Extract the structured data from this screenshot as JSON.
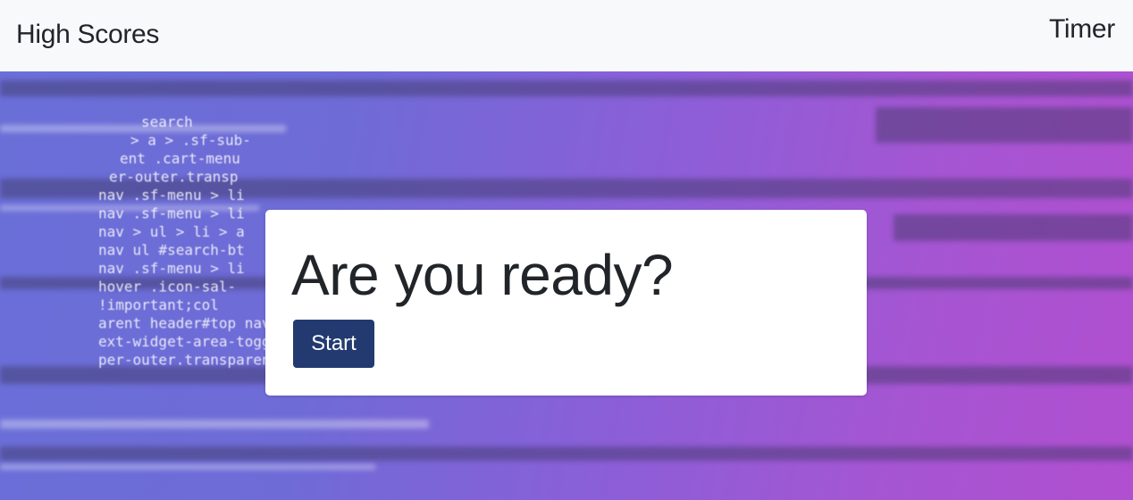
{
  "navbar": {
    "high_scores_label": "High Scores",
    "timer_label": "Timer"
  },
  "card": {
    "title": "Are you ready?",
    "start_label": "Start"
  },
  "background_code_lines": [
    "search ",
    "> a > .sf-sub-",
    "ent .cart-menu",
    "er-outer.transp",
    "nav .sf-menu > li",
    "nav .sf-menu > li",
    "nav > ul > li > a",
    "nav ul #search-bt",
    "nav .sf-menu > li",
    "hover .icon-sal-",
    "!important;col",
    "arent header#top nav>ul>li.bu",
    "ext-widget-area-toggle a i",
    "per-outer.transparent"
  ],
  "colors": {
    "navbar_bg": "#f8f9fa",
    "button_bg": "#233a70",
    "hero_left": "#6a6fd8",
    "hero_right": "#b04fd0"
  }
}
